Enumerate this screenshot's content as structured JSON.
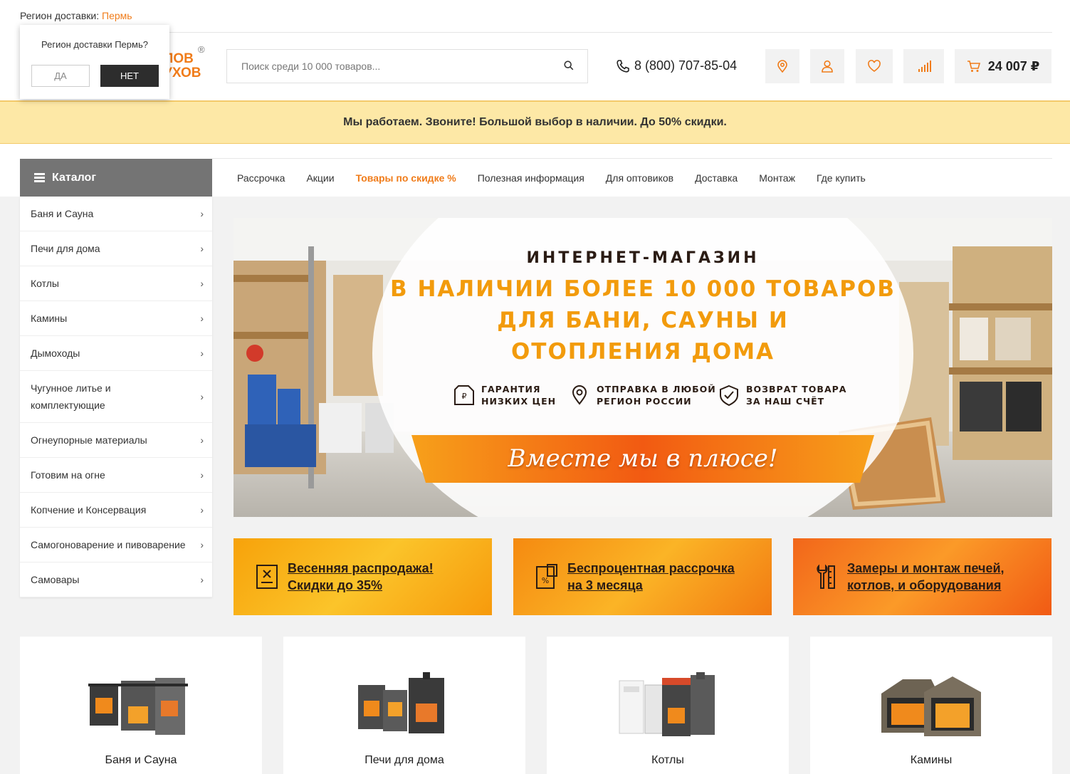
{
  "region": {
    "label": "Регион доставки:",
    "city": "Пермь"
  },
  "region_popup": {
    "question": "Регион доставки Пермь?",
    "yes": "ДА",
    "no": "НЕТ"
  },
  "logo": {
    "line1": "ЛОВ",
    "line2": "УХОВ",
    "mark": "®"
  },
  "search": {
    "placeholder": "Поиск среди 10 000 товаров..."
  },
  "phone": "8 (800) 707-85-04",
  "cart": {
    "total": "24 007 ₽"
  },
  "announcement": "Мы работаем. Звоните! Большой выбор в наличии. До 50% скидки.",
  "catalog": {
    "title": "Каталог",
    "items": [
      {
        "label": "Баня и Сауна"
      },
      {
        "label": "Печи для дома"
      },
      {
        "label": "Котлы"
      },
      {
        "label": "Камины"
      },
      {
        "label": "Дымоходы"
      },
      {
        "label": "Чугунное литье и комплектующие"
      },
      {
        "label": "Огнеупорные материалы"
      },
      {
        "label": "Готовим на огне"
      },
      {
        "label": "Копчение и Консервация"
      },
      {
        "label": "Самогоноварение и пивоварение"
      },
      {
        "label": "Самовары"
      }
    ]
  },
  "topnav": [
    {
      "label": "Рассрочка"
    },
    {
      "label": "Акции"
    },
    {
      "label": "Товары по скидке %"
    },
    {
      "label": "Полезная информация"
    },
    {
      "label": "Для оптовиков"
    },
    {
      "label": "Доставка"
    },
    {
      "label": "Монтаж"
    },
    {
      "label": "Где купить"
    }
  ],
  "banner": {
    "subtitle": "ИНТЕРНЕТ-МАГАЗИН",
    "line1": "В НАЛИЧИИ БОЛЕЕ 10 000 ТОВАРОВ",
    "line2": "ДЛЯ БАНИ, САУНЫ И",
    "line3": "ОТОПЛЕНИЯ ДОМА",
    "features": [
      {
        "l1": "ГАРАНТИЯ",
        "l2": "НИЗКИХ ЦЕН"
      },
      {
        "l1": "ОТПРАВКА В ЛЮБОЙ",
        "l2": "РЕГИОН РОССИИ"
      },
      {
        "l1": "ВОЗВРАТ ТОВАРА",
        "l2": "ЗА НАШ СЧЁТ"
      }
    ],
    "slogan": "Вместе мы в плюсе!"
  },
  "promos": [
    {
      "l1": "Весенняя распродажа!",
      "l2": "Скидки до 35%"
    },
    {
      "l1": "Беспроцентная рассрочка",
      "l2": "на 3 месяца"
    },
    {
      "l1": "Замеры и монтаж печей,",
      "l2": "котлов, и оборудования"
    }
  ],
  "tiles": [
    {
      "label": "Баня и Сауна"
    },
    {
      "label": "Печи для дома"
    },
    {
      "label": "Котлы"
    },
    {
      "label": "Камины"
    }
  ],
  "colors": {
    "accent": "#f07c1a",
    "banner_orange": "#f29b0c",
    "strip": "#fde8a6",
    "catalog_head": "#747474"
  }
}
